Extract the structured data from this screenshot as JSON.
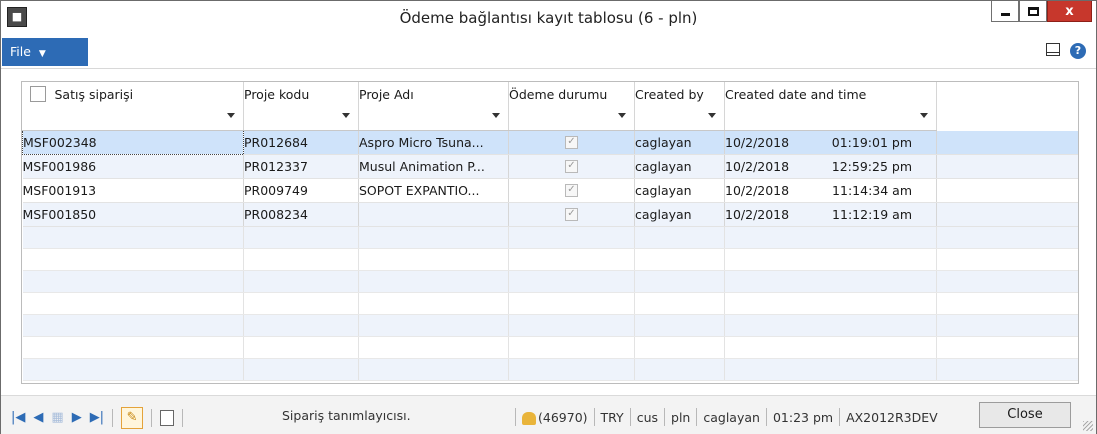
{
  "window": {
    "title": "Ödeme bağlantısı kayıt tablosu (6 - pln)",
    "app_icon": "dynamics-ax-icon"
  },
  "ribbon": {
    "file_label": "File"
  },
  "grid": {
    "columns": [
      "Satış siparişi",
      "Proje kodu",
      "Proje Adı",
      "Ödeme durumu",
      "Created by",
      "Created date and time"
    ],
    "rows": [
      {
        "order": "MSF002348",
        "project_code": "PR012684",
        "project_name": "Aspro Micro Tsuna...",
        "payment_status": true,
        "created_by": "caglayan",
        "date": "10/2/2018",
        "time": "01:19:01 pm"
      },
      {
        "order": "MSF001986",
        "project_code": "PR012337",
        "project_name": "Musul Animation P...",
        "payment_status": true,
        "created_by": "caglayan",
        "date": "10/2/2018",
        "time": "12:59:25 pm"
      },
      {
        "order": "MSF001913",
        "project_code": "PR009749",
        "project_name": "SOPOT EXPANTIO...",
        "payment_status": true,
        "created_by": "caglayan",
        "date": "10/2/2018",
        "time": "11:14:34 am"
      },
      {
        "order": "MSF001850",
        "project_code": "PR008234",
        "project_name": "",
        "payment_status": true,
        "created_by": "caglayan",
        "date": "10/2/2018",
        "time": "11:12:19 am"
      }
    ],
    "selected_row": 0
  },
  "statusbar": {
    "help_text": "Sipariş tanımlayıcısı.",
    "notifications": "(46970)",
    "currency": "TRY",
    "company": "cus",
    "partition": "pln",
    "user": "caglayan",
    "time": "01:23 pm",
    "server": "AX2012R3DEV",
    "close_label": "Close"
  }
}
